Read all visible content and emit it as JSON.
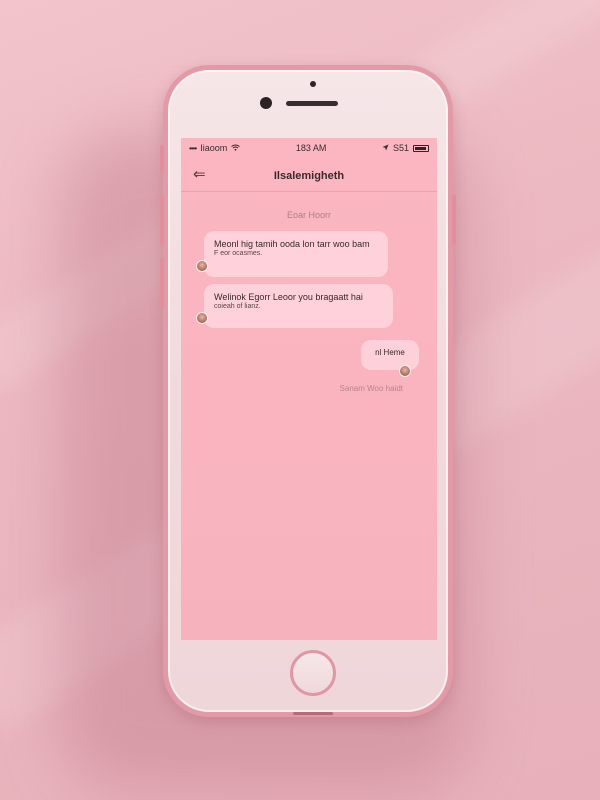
{
  "status_bar": {
    "carrier": "Iiaoom",
    "signal": "••••",
    "wifi_icon": "wifi-icon",
    "time": "183 AM",
    "location_icon": "location-arrow-icon",
    "battery_level": "S51"
  },
  "nav": {
    "back_icon": "back-arrow-icon",
    "title": "Ilsalemigheth"
  },
  "chat": {
    "date_label": "Eoar Hoorr",
    "messages": [
      {
        "line1": "Meonl hig tamih ooda lon tarr woo bam",
        "line2": "F eor ocasmes.",
        "sender": "incoming"
      },
      {
        "line1": "Welinok Egorr Leoor you bragaatt hai",
        "line2": "coieah of lianz.",
        "sender": "incoming"
      },
      {
        "line1": "nl Heme",
        "line2": "",
        "sender": "outgoing"
      }
    ],
    "read_receipt": "Sanam Woo haidt"
  },
  "colors": {
    "background": "#ecb8c1",
    "phone_frame": "#e49aa6",
    "screen": "#f9b4bf",
    "bubble": "#ffd6de"
  }
}
